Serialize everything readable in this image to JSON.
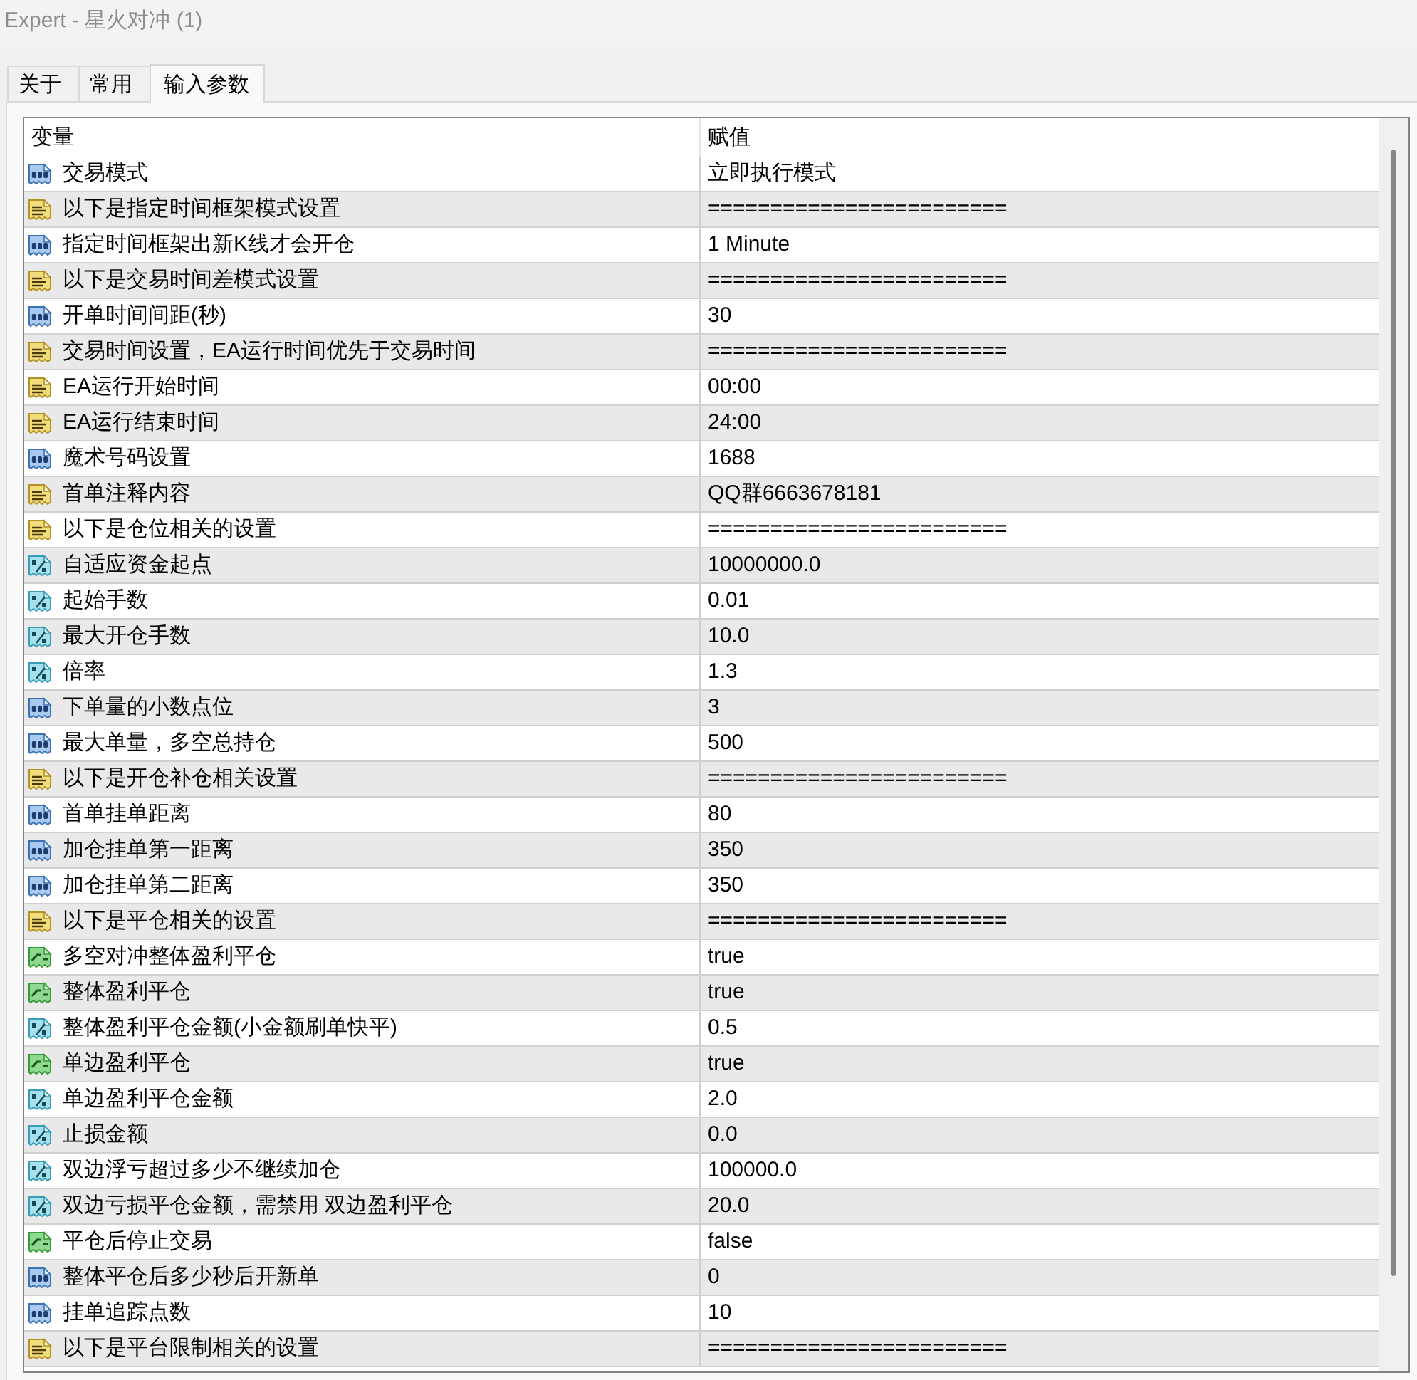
{
  "window": {
    "title": "Expert - 星火对冲 (1)"
  },
  "tabs": [
    {
      "label": "关于",
      "selected": false
    },
    {
      "label": "常用",
      "selected": false
    },
    {
      "label": "输入参数",
      "selected": true
    }
  ],
  "table": {
    "columns": [
      "变量",
      "赋值"
    ],
    "rows": [
      {
        "kind": "int",
        "name": "交易模式",
        "value": "立即执行模式"
      },
      {
        "kind": "string",
        "name": "以下是指定时间框架模式设置",
        "value": "========================"
      },
      {
        "kind": "int",
        "name": "指定时间框架出新K线才会开仓",
        "value": "1 Minute"
      },
      {
        "kind": "string",
        "name": "以下是交易时间差模式设置",
        "value": "========================"
      },
      {
        "kind": "int",
        "name": "开单时间间距(秒)",
        "value": "30"
      },
      {
        "kind": "string",
        "name": "交易时间设置，EA运行时间优先于交易时间",
        "value": "========================"
      },
      {
        "kind": "string",
        "name": "EA运行开始时间",
        "value": "00:00"
      },
      {
        "kind": "string",
        "name": "EA运行结束时间",
        "value": "24:00"
      },
      {
        "kind": "int",
        "name": "魔术号码设置",
        "value": "1688"
      },
      {
        "kind": "string",
        "name": "首单注释内容",
        "value": "QQ群6663678181"
      },
      {
        "kind": "string",
        "name": "以下是仓位相关的设置",
        "value": "========================"
      },
      {
        "kind": "double",
        "name": "自适应资金起点",
        "value": "10000000.0"
      },
      {
        "kind": "double",
        "name": "起始手数",
        "value": "0.01"
      },
      {
        "kind": "double",
        "name": "最大开仓手数",
        "value": "10.0"
      },
      {
        "kind": "double",
        "name": "倍率",
        "value": "1.3"
      },
      {
        "kind": "int",
        "name": "下单量的小数点位",
        "value": "3"
      },
      {
        "kind": "int",
        "name": "最大单量，多空总持仓",
        "value": "500"
      },
      {
        "kind": "string",
        "name": "以下是开仓补仓相关设置",
        "value": "========================"
      },
      {
        "kind": "int",
        "name": "首单挂单距离",
        "value": "80"
      },
      {
        "kind": "int",
        "name": "加仓挂单第一距离",
        "value": "350"
      },
      {
        "kind": "int",
        "name": "加仓挂单第二距离",
        "value": "350"
      },
      {
        "kind": "string",
        "name": "以下是平仓相关的设置",
        "value": "========================"
      },
      {
        "kind": "bool",
        "name": "多空对冲整体盈利平仓",
        "value": "true"
      },
      {
        "kind": "bool",
        "name": "整体盈利平仓",
        "value": "true"
      },
      {
        "kind": "double",
        "name": "整体盈利平仓金额(小金额刷单快平)",
        "value": "0.5"
      },
      {
        "kind": "bool",
        "name": "单边盈利平仓",
        "value": "true"
      },
      {
        "kind": "double",
        "name": "单边盈利平仓金额",
        "value": "2.0"
      },
      {
        "kind": "double",
        "name": "止损金额",
        "value": "0.0"
      },
      {
        "kind": "double",
        "name": "双边浮亏超过多少不继续加仓",
        "value": "100000.0"
      },
      {
        "kind": "double",
        "name": "双边亏损平仓金额，需禁用 双边盈利平仓",
        "value": "20.0"
      },
      {
        "kind": "bool",
        "name": "平仓后停止交易",
        "value": "false"
      },
      {
        "kind": "int",
        "name": "整体平仓后多少秒后开新单",
        "value": "0"
      },
      {
        "kind": "int",
        "name": "挂单追踪点数",
        "value": "10"
      },
      {
        "kind": "string",
        "name": "以下是平台限制相关的设置",
        "value": "========================"
      }
    ]
  }
}
